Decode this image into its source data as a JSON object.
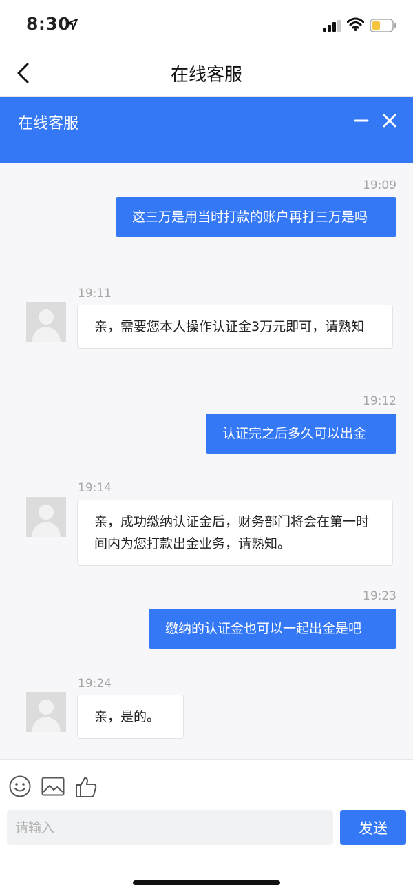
{
  "status_bar": {
    "time": "8:30"
  },
  "nav": {
    "title": "在线客服"
  },
  "cs_panel": {
    "title": "在线客服"
  },
  "messages": [
    {
      "dir": "out",
      "time": "19:09",
      "text": "这三万是用当时打款的账户再打三万是吗"
    },
    {
      "dir": "in",
      "time": "19:11",
      "text": "亲，需要您本人操作认证金3万元即可，请熟知"
    },
    {
      "dir": "out",
      "time": "19:12",
      "text": "认证完之后多久可以出金"
    },
    {
      "dir": "in",
      "time": "19:14",
      "text": "亲，成功缴纳认证金后，财务部门将会在第一时间内为您打款出金业务，请熟知。"
    },
    {
      "dir": "out",
      "time": "19:23",
      "text": "缴纳的认证金也可以一起出金是吧"
    },
    {
      "dir": "in",
      "time": "19:24",
      "text": "亲，是的。"
    }
  ],
  "input": {
    "placeholder": "请输入",
    "value": ""
  },
  "send_label": "发送",
  "colors": {
    "accent": "#3478f6",
    "chat_bg": "#f7f7f9",
    "time_text": "#a6a6a6"
  },
  "icons": [
    "location-arrow-icon",
    "signal-icon",
    "wifi-icon",
    "battery-icon",
    "back-chevron-icon",
    "minimize-icon",
    "close-icon",
    "emoji-icon",
    "image-icon",
    "thumbs-up-icon"
  ]
}
